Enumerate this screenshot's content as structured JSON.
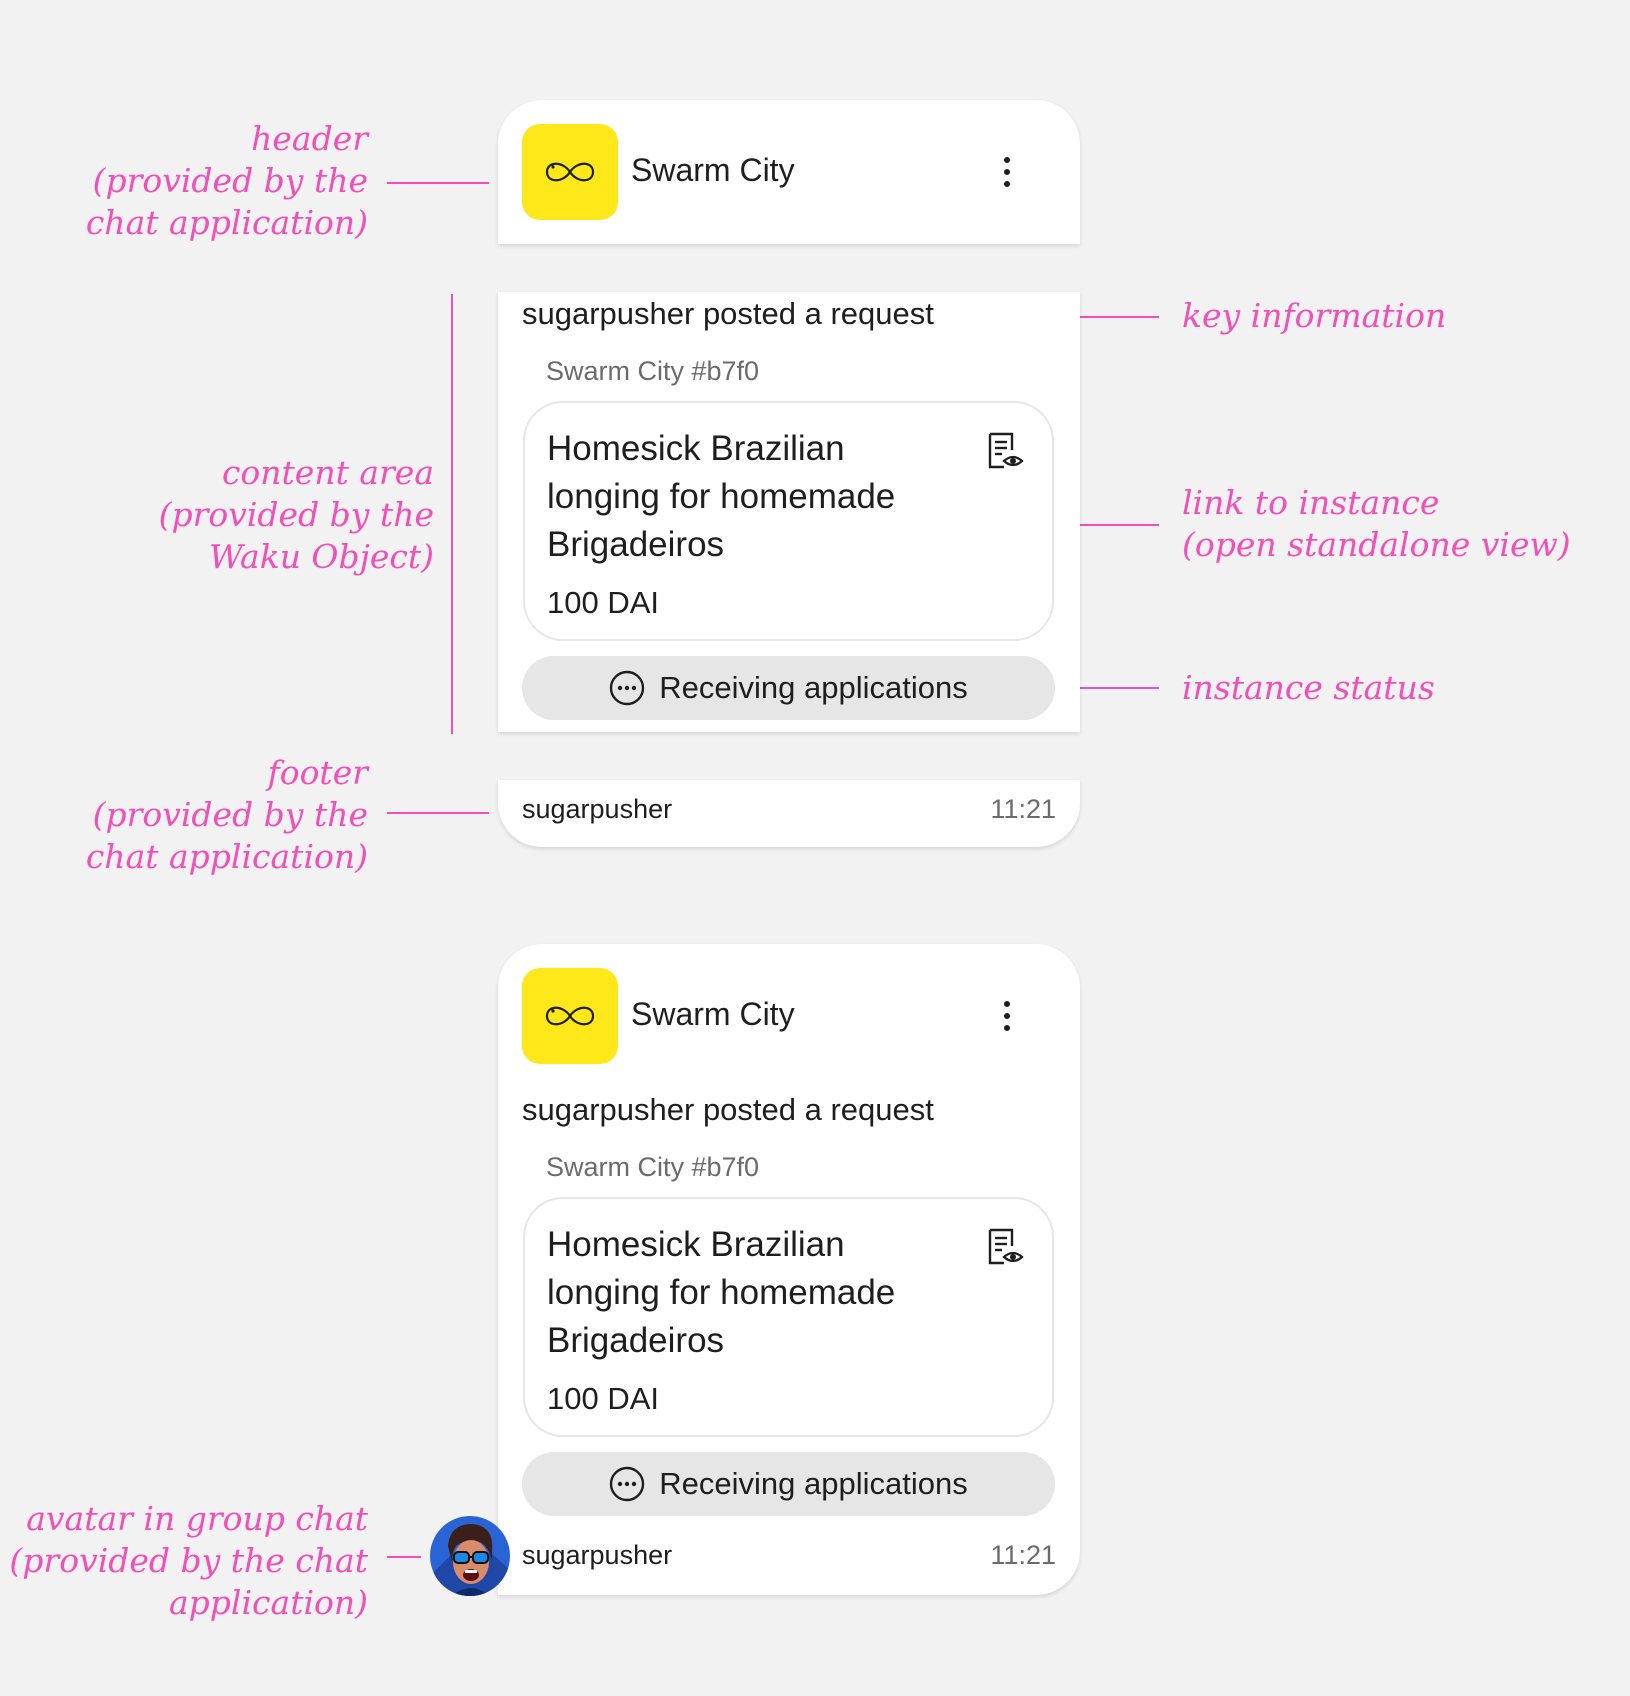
{
  "annotations": {
    "header": [
      "header",
      "(provided by the",
      "chat application)"
    ],
    "content_area": [
      "content area",
      "(provided by the",
      "Waku Object)"
    ],
    "footer": [
      "footer",
      "(provided by the",
      "chat application)"
    ],
    "key_information": [
      "key information"
    ],
    "link_to_instance": [
      "link to instance",
      "(open standalone view)"
    ],
    "instance_status": [
      "instance status"
    ],
    "avatar_group_chat": [
      "avatar in group chat",
      "(provided by the chat",
      "application)"
    ]
  },
  "message": {
    "app_name": "Swarm City",
    "app_icon": "infinity-icon",
    "menu_icon": "more-vertical-icon",
    "key_info": "sugarpusher posted a request",
    "instance_id": "Swarm City #b7f0",
    "instance_title": "Homesick Brazilian longing for homemade Brigadeiros",
    "instance_amount": "100 DAI",
    "instance_link_icon": "document-view-icon",
    "status_icon": "more-horizontal-circle-icon",
    "status": "Receiving applications",
    "sender": "sugarpusher",
    "time": "11:21"
  },
  "colors": {
    "annotation": "#f24fb8",
    "app_icon_bg": "#ffe81a",
    "background": "#f2f2f2",
    "pill_bg": "#e6e6e6"
  }
}
